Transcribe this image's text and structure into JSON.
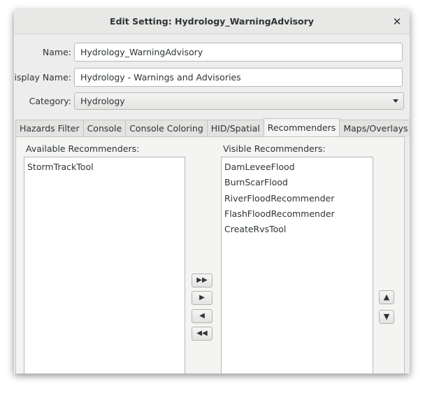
{
  "dialog": {
    "title": "Edit Setting: Hydrology_WarningAdvisory",
    "close_icon": "✕"
  },
  "form": {
    "name_label": "Name:",
    "name_value": "Hydrology_WarningAdvisory",
    "display_name_label": "Display Name:",
    "display_name_value": "Hydrology - Warnings and Advisories",
    "category_label": "Category:",
    "category_value": "Hydrology"
  },
  "tabs": [
    {
      "label": "Hazards Filter"
    },
    {
      "label": "Console"
    },
    {
      "label": "Console Coloring"
    },
    {
      "label": "HID/Spatial"
    },
    {
      "label": "Recommenders"
    },
    {
      "label": "Maps/Overlays"
    }
  ],
  "active_tab": "Recommenders",
  "recommenders": {
    "available_label": "Available Recommenders:",
    "visible_label": "Visible Recommenders:",
    "available": [
      "StormTrackTool"
    ],
    "visible": [
      "DamLeveeFlood",
      "BurnScarFlood",
      "RiverFloodRecommender",
      "FlashFloodRecommender",
      "CreateRvsTool"
    ]
  },
  "buttons": {
    "move_all_right": "▶▶",
    "move_right": "▶",
    "move_left": "◀",
    "move_all_left": "◀◀",
    "move_up": "▲",
    "move_down": "▼"
  }
}
